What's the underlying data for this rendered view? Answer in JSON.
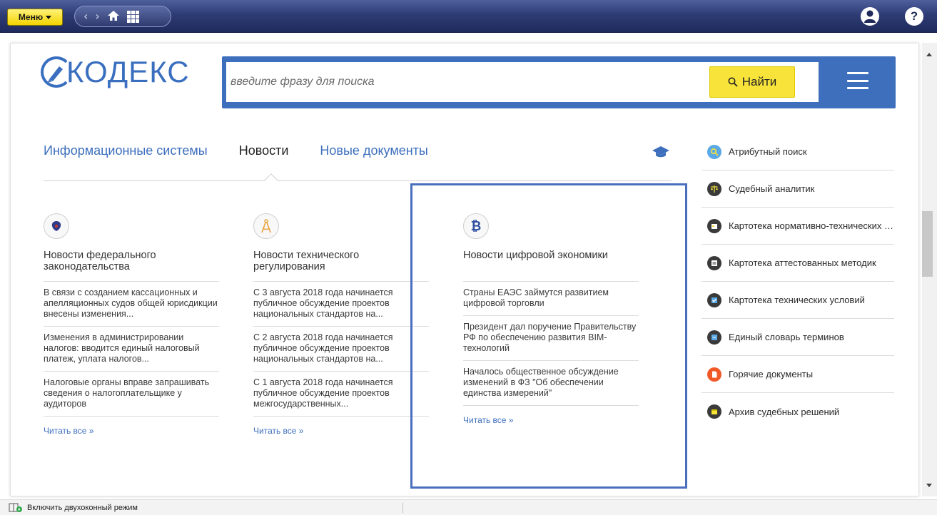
{
  "topbar": {
    "menu_label": "Меню",
    "icons": [
      "back-icon",
      "forward-icon",
      "home-icon",
      "grid-icon",
      "user-icon",
      "help-icon"
    ]
  },
  "logo": {
    "text": "КОДЕКС"
  },
  "search": {
    "placeholder": "введите фразу для поиска",
    "button_label": "Найти"
  },
  "tabs": [
    {
      "label": "Информационные системы",
      "active": false
    },
    {
      "label": "Новости",
      "active": true
    },
    {
      "label": "Новые документы",
      "active": false
    }
  ],
  "news_columns": [
    {
      "icon": "coat-of-arms-icon",
      "title": "Новости федерального законодательства",
      "items": [
        "В связи с созданием кассационных и апелляционных судов общей юрисдикции внесены изменения...",
        "Изменения в администрировании налогов: вводится единый налоговый платеж, уплата налогов...",
        "Налоговые органы вправе запрашивать сведения о налогоплательщике у аудиторов"
      ],
      "read_all": "Читать все »"
    },
    {
      "icon": "compass-icon",
      "title": "Новости технического регулирования",
      "items": [
        "С 3 августа 2018 года начинается публичное обсуждение проектов национальных стандартов на...",
        "С 2 августа 2018 года начинается публичное обсуждение проектов национальных стандартов на...",
        "С 1 августа 2018 года начинается публичное обсуждение проектов межгосударственных..."
      ],
      "read_all": "Читать все »"
    },
    {
      "icon": "bitcoin-icon",
      "title": "Новости цифровой экономики",
      "items": [
        "Страны ЕАЭС займутся развитием цифровой торговли",
        "Президент дал поручение Правительству РФ по обеспечению развития BIM-технологий",
        "Началось общественное обсуждение изменений в ФЗ \"Об обеспечении единства измерений\""
      ],
      "read_all": "Читать все »"
    }
  ],
  "sidebar": {
    "items": [
      {
        "label": "Атрибутный поиск",
        "icon": "attribute-search-icon",
        "color": "#5aa9e6"
      },
      {
        "label": "Судебный аналитик",
        "icon": "scales-icon",
        "color": "#3a3a3a"
      },
      {
        "label": "Картотека нормативно-технических документов",
        "icon": "catalog-icon",
        "color": "#3a3a3a"
      },
      {
        "label": "Картотека аттестованных методик",
        "icon": "catalog-icon",
        "color": "#3a3a3a"
      },
      {
        "label": "Картотека технических условий",
        "icon": "catalog-icon",
        "color": "#3a3a3a"
      },
      {
        "label": "Единый словарь терминов",
        "icon": "dictionary-icon",
        "color": "#3a3a3a"
      },
      {
        "label": "Горячие документы",
        "icon": "hot-document-icon",
        "color": "#f05a28"
      },
      {
        "label": "Архив судебных решений",
        "icon": "archive-icon",
        "color": "#3a3a3a"
      }
    ]
  },
  "statusbar": {
    "label": "Включить двухоконный режим"
  },
  "colors": {
    "accent": "#3d6fbd",
    "search_button": "#f7e33a",
    "topbar": "#2e3c75"
  }
}
